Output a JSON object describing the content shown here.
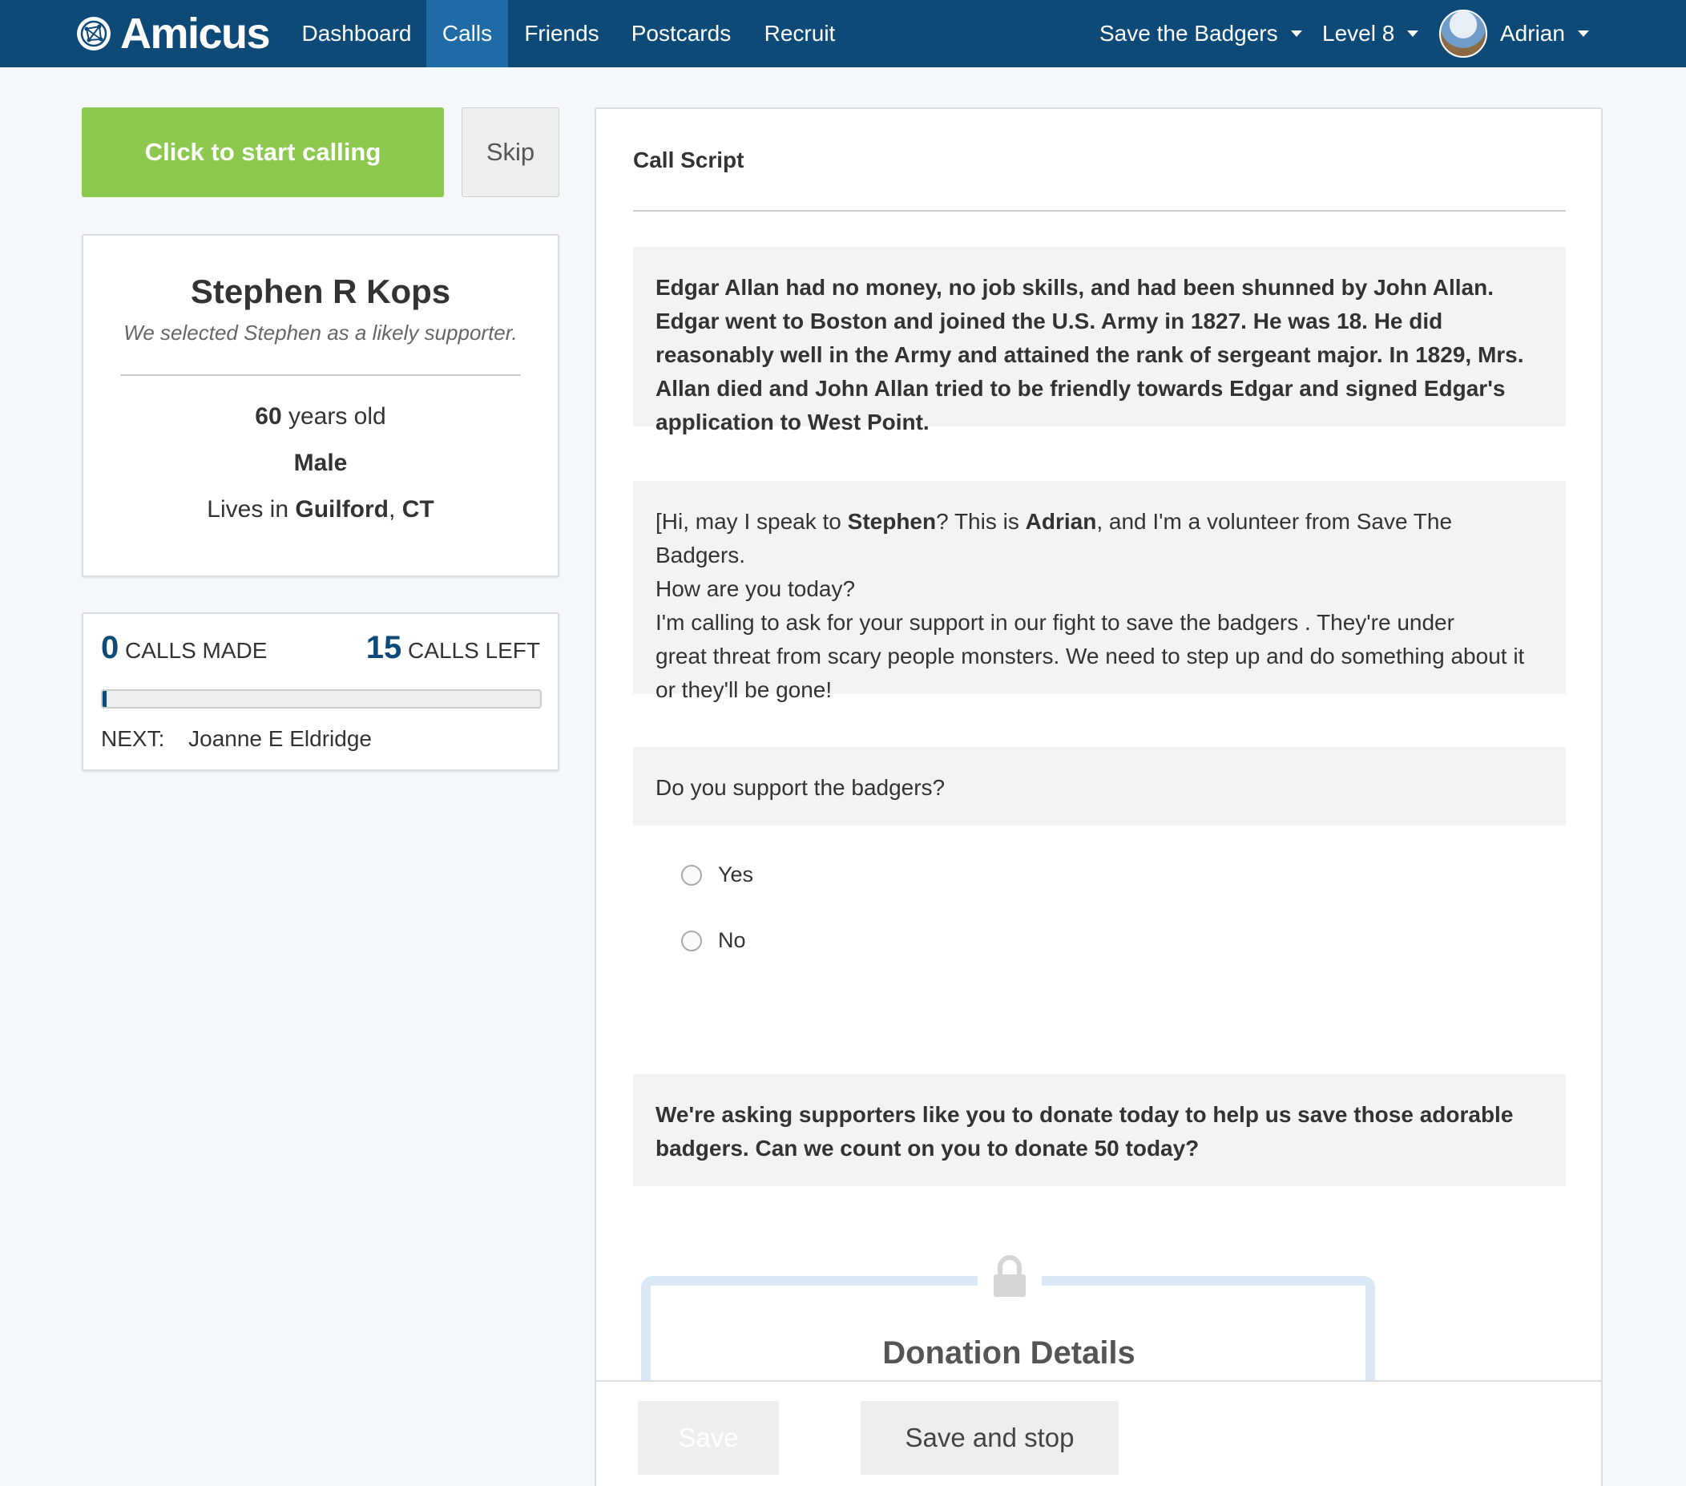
{
  "navbar": {
    "brand": "Amicus",
    "items": [
      {
        "label": "Dashboard"
      },
      {
        "label": "Calls",
        "active": true
      },
      {
        "label": "Friends"
      },
      {
        "label": "Postcards"
      },
      {
        "label": "Recruit"
      }
    ],
    "campaign": "Save the Badgers",
    "level": "Level 8",
    "user": "Adrian"
  },
  "calling": {
    "start_label": "Click to start calling",
    "skip_label": "Skip"
  },
  "contact": {
    "name": "Stephen R Kops",
    "subtitle": "We selected Stephen as a likely supporter.",
    "age_value": "60",
    "age_suffix": " years old",
    "gender": "Male",
    "lives_prefix": "Lives in ",
    "city": "Guilford",
    "state_sep": ", ",
    "state": "CT"
  },
  "stats": {
    "calls_made": "0",
    "calls_made_label": " CALLS MADE",
    "calls_left": "15",
    "calls_left_label": " CALLS LEFT",
    "progress_fraction": 0.01,
    "next_label": "NEXT:",
    "next_name": "Joanne E Eldridge"
  },
  "script": {
    "title": "Call Script",
    "block1": "Edgar Allan had no money, no job skills, and had been shunned by John Allan. Edgar went to Boston and joined the U.S. Army in 1827. He was 18. He did reasonably well in the Army and attained the rank of sergeant major. In 1829, Mrs. Allan died and John Allan tried to be friendly towards Edgar and signed Edgar's application to West Point.",
    "block2": {
      "p1": "[Hi, may I speak to ",
      "contact": "Stephen",
      "p2": "? This is ",
      "caller": "Adrian",
      "p3": ", and I'm a volunteer from Save The Badgers.",
      "p4": "How are you today?",
      "p5": "I'm calling to ask for your support in our fight to save the badgers . They're under",
      "p6": "great threat from scary people monsters. We need to step up and do something about it or they'll be gone!"
    },
    "question": "Do you support the badgers?",
    "options": [
      "Yes",
      "No"
    ],
    "ask": "We're asking supporters like you to donate today to help us save those adorable badgers. Can we count on you to donate 50 today?",
    "donation_title": "Donation Details"
  },
  "footer": {
    "save_label": "Save",
    "save_stop_label": "Save and stop"
  },
  "colors": {
    "navbar": "#0e4a78",
    "nav_active": "#1f6ba6",
    "start_button": "#8cc94e",
    "accent_number": "#0e4a78",
    "script_bg": "#f1f3f5"
  }
}
